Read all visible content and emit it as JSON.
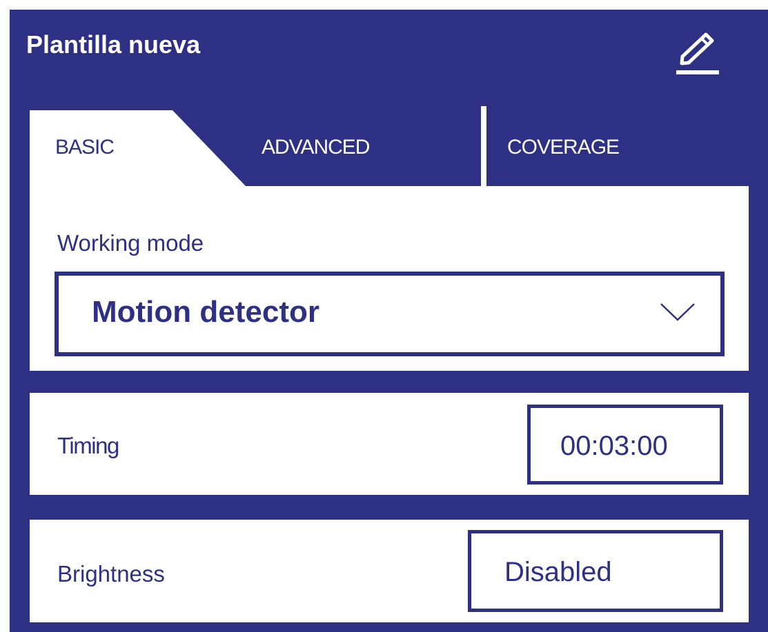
{
  "header": {
    "title": "Plantilla nueva",
    "edit_icon": "pencil-edit-icon"
  },
  "tabs": [
    {
      "label": "BASIC",
      "active": true
    },
    {
      "label": "ADVANCED",
      "active": false
    },
    {
      "label": "COVERAGE",
      "active": false
    }
  ],
  "working_mode": {
    "label": "Working mode",
    "value": "Motion detector",
    "dropdown_icon": "chevron-down-icon"
  },
  "timing": {
    "label": "Timing",
    "value": "00:03:00"
  },
  "brightness": {
    "label": "Brightness",
    "value": "Disabled"
  },
  "colors": {
    "background": "#2e3084",
    "panel": "#ffffff",
    "text": "#2e3084"
  }
}
